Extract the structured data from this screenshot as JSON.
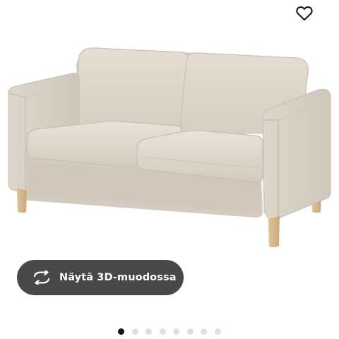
{
  "product": {
    "image_alt": "Beige 2-seat sofa with light wooden legs",
    "favorite_icon": "heart-outline-icon"
  },
  "view_3d": {
    "label": "Näytä 3D-muodossa",
    "icon": "rotate-arrows-icon"
  },
  "carousel": {
    "total": 8,
    "active_index": 0
  },
  "colors": {
    "button_bg": "#484848",
    "button_text": "#ffffff",
    "dot_active": "#111111",
    "dot_inactive": "#dfdfdf",
    "sofa_fabric": "#ddd6cb",
    "sofa_legs": "#d9b98f"
  }
}
